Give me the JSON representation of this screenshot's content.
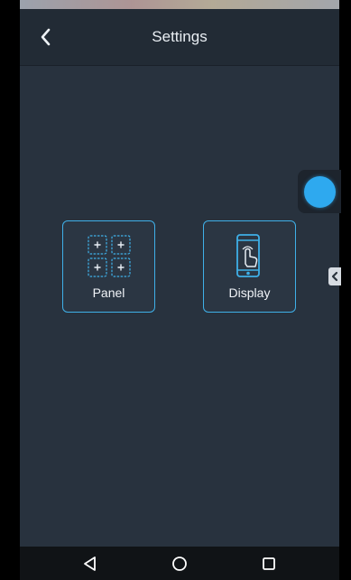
{
  "header": {
    "title": "Settings",
    "back_icon": "chevron-left-icon"
  },
  "tiles": [
    {
      "label": "Panel",
      "icon": "panel-grid-icon"
    },
    {
      "label": "Display",
      "icon": "display-touch-icon"
    }
  ],
  "floating_button": {
    "icon": "assistive-touch-ball-icon"
  },
  "navigation_bar": {
    "back_icon": "triangle-back-icon",
    "home_icon": "circle-home-icon",
    "recent_icon": "square-recent-apps-icon"
  },
  "colors": {
    "background": "#28323e",
    "header": "#222b35",
    "accent": "#3fb0e8",
    "ball": "#2ea9ef",
    "nav_bar": "#101316"
  }
}
